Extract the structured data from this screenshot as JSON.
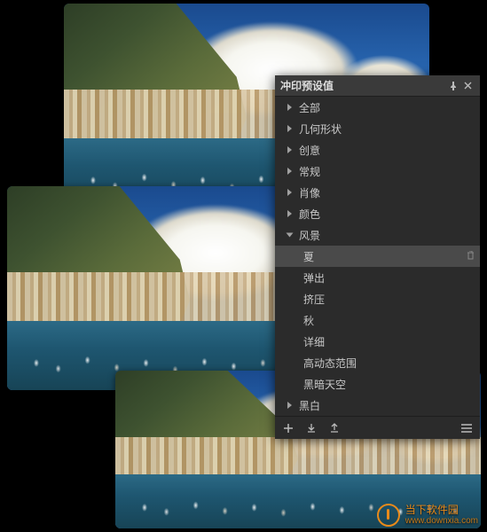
{
  "panel": {
    "title": "冲印预设值",
    "categories": [
      {
        "label": "全部",
        "expanded": false
      },
      {
        "label": "几何形状",
        "expanded": false
      },
      {
        "label": "创意",
        "expanded": false
      },
      {
        "label": "常规",
        "expanded": false
      },
      {
        "label": "肖像",
        "expanded": false
      },
      {
        "label": "颜色",
        "expanded": false
      },
      {
        "label": "风景",
        "expanded": true
      }
    ],
    "landscape_presets": [
      {
        "label": "夏",
        "selected": true
      },
      {
        "label": "弹出",
        "selected": false
      },
      {
        "label": "挤压",
        "selected": false
      },
      {
        "label": "秋",
        "selected": false
      },
      {
        "label": "详细",
        "selected": false
      },
      {
        "label": "高动态范围",
        "selected": false
      },
      {
        "label": "黑暗天空",
        "selected": false
      }
    ],
    "last_category": {
      "label": "黑白",
      "expanded": false
    }
  },
  "watermark": {
    "name": "当下软件园",
    "url": "www.downxia.com"
  }
}
